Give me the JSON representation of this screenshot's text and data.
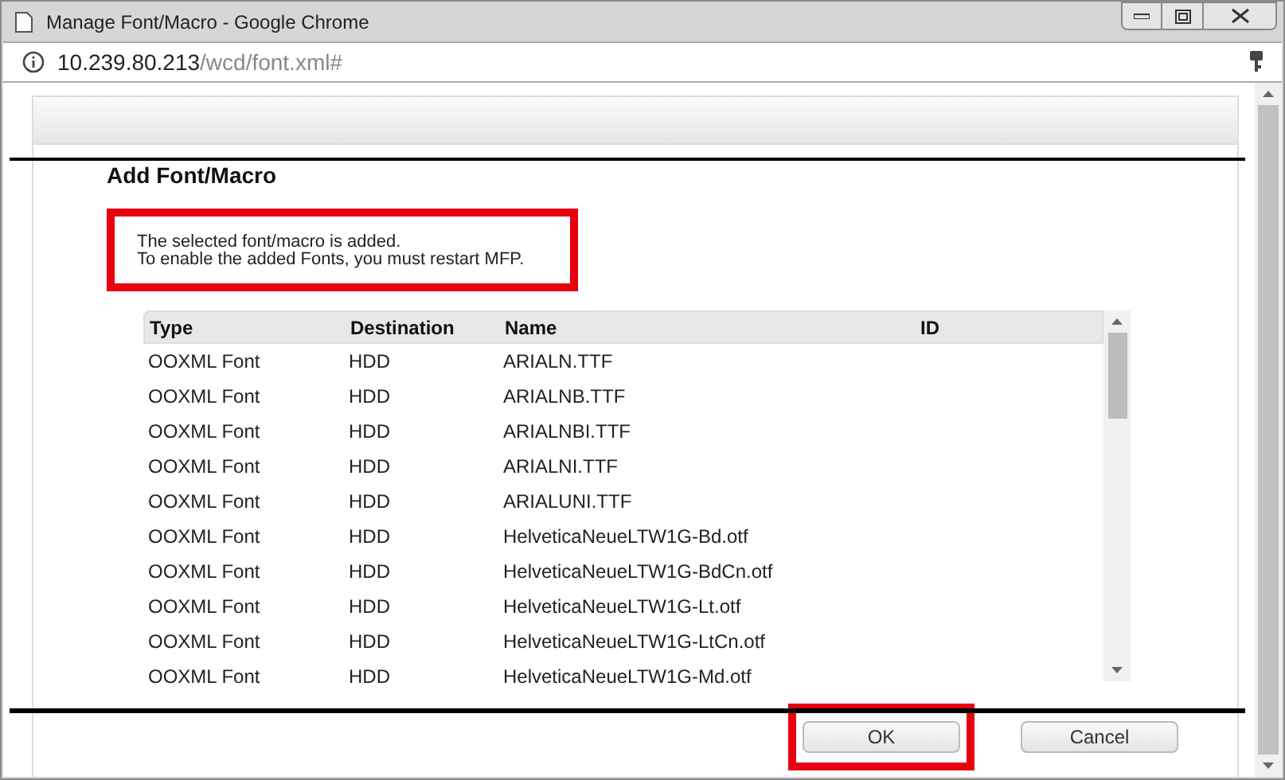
{
  "window": {
    "title": "Manage Font/Macro - Google Chrome"
  },
  "address_bar": {
    "host": "10.239.80.213",
    "path": "/wcd/font.xml#"
  },
  "dialog": {
    "title": "Add Font/Macro",
    "message": {
      "lines": [
        "The selected font/macro is added.",
        "To enable the added Fonts, you must restart MFP."
      ],
      "highlighted": true
    },
    "table": {
      "columns": [
        "Type",
        "Destination",
        "Name",
        "ID"
      ],
      "rows": [
        [
          "OOXML Font",
          "HDD",
          "ARIALN.TTF",
          ""
        ],
        [
          "OOXML Font",
          "HDD",
          "ARIALNB.TTF",
          ""
        ],
        [
          "OOXML Font",
          "HDD",
          "ARIALNBI.TTF",
          ""
        ],
        [
          "OOXML Font",
          "HDD",
          "ARIALNI.TTF",
          ""
        ],
        [
          "OOXML Font",
          "HDD",
          "ARIALUNI.TTF",
          ""
        ],
        [
          "OOXML Font",
          "HDD",
          "HelveticaNeueLTW1G-Bd.otf",
          ""
        ],
        [
          "OOXML Font",
          "HDD",
          "HelveticaNeueLTW1G-BdCn.otf",
          ""
        ],
        [
          "OOXML Font",
          "HDD",
          "HelveticaNeueLTW1G-Lt.otf",
          ""
        ],
        [
          "OOXML Font",
          "HDD",
          "HelveticaNeueLTW1G-LtCn.otf",
          ""
        ],
        [
          "OOXML Font",
          "HDD",
          "HelveticaNeueLTW1G-Md.otf",
          ""
        ]
      ]
    },
    "buttons": [
      {
        "label": "OK",
        "highlighted": true
      },
      {
        "label": "Cancel",
        "highlighted": false
      }
    ]
  }
}
